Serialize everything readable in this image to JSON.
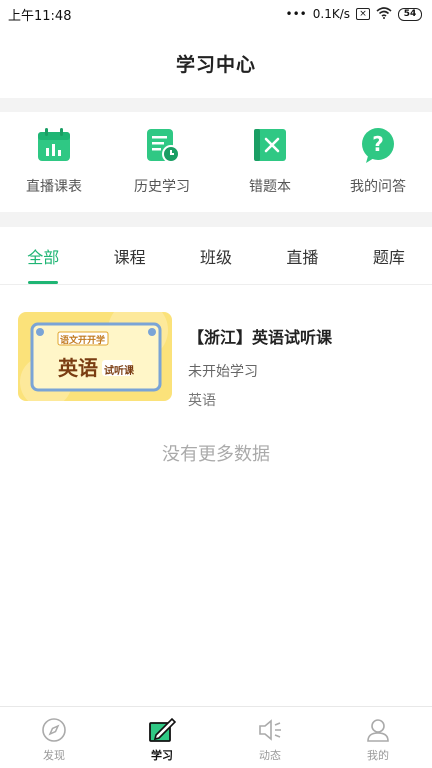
{
  "status_bar": {
    "time": "上午11:48",
    "net_speed": "0.1K/s",
    "sim": "×",
    "battery": "54"
  },
  "header": {
    "title": "学习中心"
  },
  "quick_actions": [
    {
      "label": "直播课表",
      "icon": "calendar-icon"
    },
    {
      "label": "历史学习",
      "icon": "history-icon"
    },
    {
      "label": "错题本",
      "icon": "error-book-icon"
    },
    {
      "label": "我的问答",
      "icon": "question-icon"
    }
  ],
  "tabs": [
    {
      "label": "全部",
      "active": true
    },
    {
      "label": "课程",
      "active": false
    },
    {
      "label": "班级",
      "active": false
    },
    {
      "label": "直播",
      "active": false
    },
    {
      "label": "题库",
      "active": false
    }
  ],
  "course": {
    "title": "【浙江】英语试听课",
    "status": "未开始学习",
    "subject": "英语",
    "thumb_text_small": "语文开开学",
    "thumb_text_big": "英语",
    "thumb_text_tag": "试听课"
  },
  "empty_note": "没有更多数据",
  "bottom_nav": [
    {
      "label": "发现",
      "icon": "compass-icon",
      "active": false
    },
    {
      "label": "学习",
      "icon": "study-icon",
      "active": true
    },
    {
      "label": "动态",
      "icon": "speaker-icon",
      "active": false
    },
    {
      "label": "我的",
      "icon": "user-icon",
      "active": false
    }
  ],
  "colors": {
    "accent": "#1fb574",
    "accent_light": "#2fc884",
    "band": "#f3f3f3"
  }
}
